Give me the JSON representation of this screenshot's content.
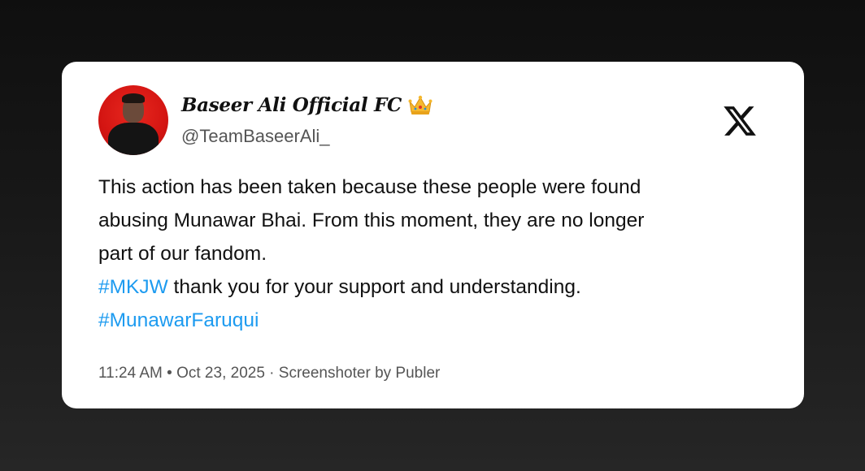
{
  "tweet": {
    "display_name": "Baseer Ali Official FC",
    "handle": "@TeamBaseerAli_",
    "badge_icon": "crown-icon",
    "platform_icon": "x-logo-icon",
    "text_lines": [
      "This action has been taken because these people were found",
      "abusing Munawar Bhai. From this moment, they are no longer",
      "part of our fandom."
    ],
    "hashtag_line": {
      "hashtag": "#MKJW",
      "rest": " thank you for your support and understanding."
    },
    "hashtag_2": "#MunawarFaruqui",
    "meta": {
      "time": "11:24 AM",
      "separator_1": " • ",
      "date": "Oct 23, 2025",
      "separator_2": " · ",
      "source": "Screenshoter by Publer"
    }
  },
  "colors": {
    "hashtag": "#1d9bf0",
    "text": "#111111",
    "muted": "#555555",
    "card": "#ffffff",
    "avatar_bg": "#d41512"
  }
}
